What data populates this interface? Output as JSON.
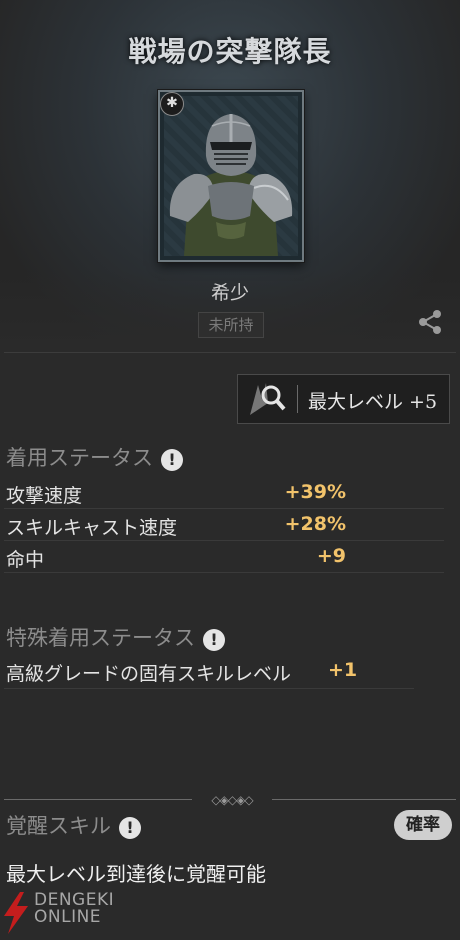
{
  "header": {
    "title": "戦場の突撃隊長",
    "rank_badge_icon": "star-badge-icon",
    "rarity": "希少",
    "ownership_status": "未所持",
    "share_icon": "share-icon"
  },
  "max_level": {
    "icon": "magnifier-search-icon",
    "label": "最大レベル +5"
  },
  "equip_status": {
    "title": "着用ステータス",
    "info_icon": "!",
    "stats": [
      {
        "name": "攻撃速度",
        "value": "+39%"
      },
      {
        "name": "スキルキャスト速度",
        "value": "+28%"
      },
      {
        "name": "命中",
        "value": "+9"
      }
    ]
  },
  "special_status": {
    "title": "特殊着用ステータス",
    "info_icon": "!",
    "stats": [
      {
        "name": "高級グレードの固有スキルレベル",
        "value": "+1"
      }
    ]
  },
  "awakening": {
    "title": "覚醒スキル",
    "info_icon": "!",
    "probability_button": "確率",
    "description": "最大レベル到達後に覚醒可能"
  },
  "watermark": {
    "line1": "DENGEKI",
    "line2": "ONLINE"
  },
  "colors": {
    "background": "#2a2a2a",
    "stat_value": "#f2c36b",
    "section_title": "#8c8c8c"
  }
}
